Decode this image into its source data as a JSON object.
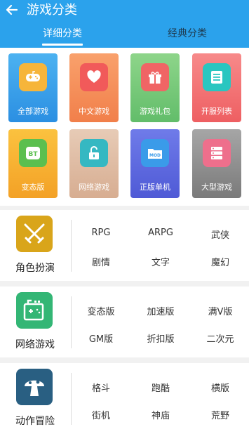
{
  "header": {
    "title": "游戏分类"
  },
  "tabs": [
    "详细分类",
    "经典分类"
  ],
  "tiles": [
    {
      "label": "全部游戏",
      "icon": "gamepad-icon"
    },
    {
      "label": "中文游戏",
      "icon": "heart-icon"
    },
    {
      "label": "游戏礼包",
      "icon": "gift-icon"
    },
    {
      "label": "开服列表",
      "icon": "list-icon"
    },
    {
      "label": "变态版",
      "icon": "bt-icon",
      "badge": "BT"
    },
    {
      "label": "网络游戏",
      "icon": "unlock-icon"
    },
    {
      "label": "正版单机",
      "icon": "mod-folder-icon",
      "badge": "MOD"
    },
    {
      "label": "大型游戏",
      "icon": "server-icon"
    }
  ],
  "categories": [
    {
      "name": "角色扮演",
      "icon": "crossed-swords-icon",
      "items": [
        "RPG",
        "ARPG",
        "武侠",
        "剧情",
        "文字",
        "魔幻"
      ]
    },
    {
      "name": "网络游戏",
      "icon": "network-game-icon",
      "items": [
        "变态版",
        "加速版",
        "满V版",
        "GM版",
        "折扣版",
        "二次元"
      ]
    },
    {
      "name": "动作冒险",
      "icon": "mushroom-icon",
      "items": [
        "格斗",
        "跑酷",
        "横版",
        "街机",
        "神庙",
        "荒野"
      ]
    }
  ]
}
